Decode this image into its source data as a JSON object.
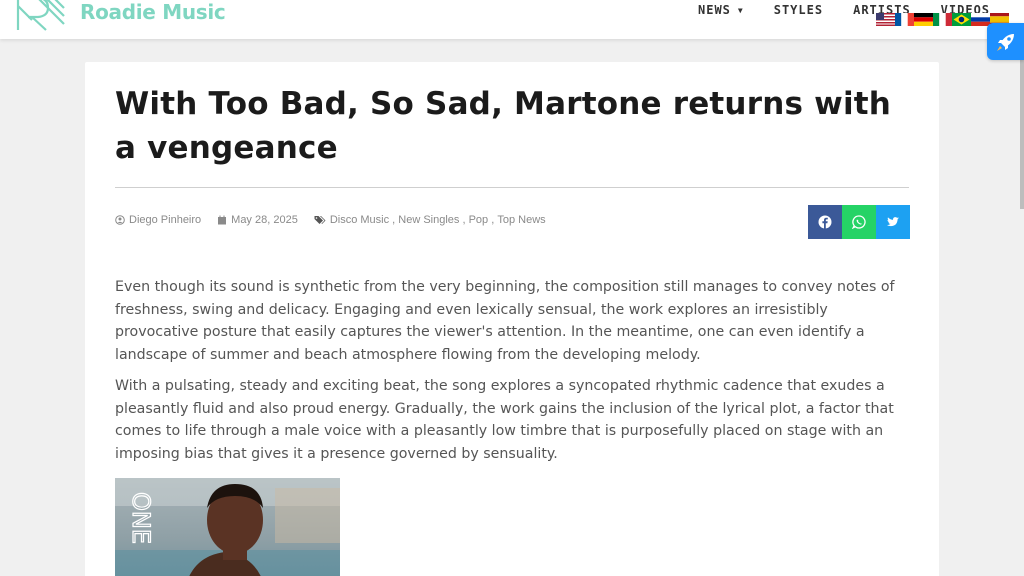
{
  "header": {
    "brand": "Roadie Music",
    "nav": [
      {
        "label": "NEWS",
        "has_dropdown": true
      },
      {
        "label": "STYLES",
        "has_dropdown": false
      },
      {
        "label": "ARTISTS",
        "has_dropdown": false
      },
      {
        "label": "VIDEOS",
        "has_dropdown": false
      }
    ],
    "flags": [
      "us-flag-icon",
      "fr-flag-icon",
      "de-flag-icon",
      "it-flag-icon",
      "br-flag-icon",
      "ru-flag-icon",
      "es-flag-icon"
    ]
  },
  "article": {
    "title": "With Too Bad, So Sad, Martone returns with a vengeance",
    "author": "Diego Pinheiro",
    "date": "May 28, 2025",
    "tags": [
      "Disco Music",
      "New Singles",
      "Pop",
      "Top News"
    ],
    "paragraphs": [
      "Even though its sound is synthetic from the very beginning, the composition still manages to convey notes of freshness, swing and delicacy. Engaging and even lexically sensual, the work explores an irresistibly provocative posture that easily captures the viewer's attention. In the meantime, one can even identify a landscape of summer and beach atmosphere flowing from the developing melody.",
      "With a pulsating, steady and exciting beat, the song explores a syncopated rhythmic cadence that exudes a pleasantly fluid and also proud energy. Gradually, the work gains the inclusion of the lyrical plot, a factor that comes to life through a male voice with a pleasantly low timbre that is purposefully placed on stage with an imposing bias that gives it a presence governed by sensuality."
    ],
    "image_caption_text": "ONE"
  },
  "colors": {
    "brand": "#7fd6c1",
    "facebook": "#3b5998",
    "whatsapp": "#25d366",
    "twitter": "#1da1f2",
    "rocket": "#1e90ff"
  }
}
